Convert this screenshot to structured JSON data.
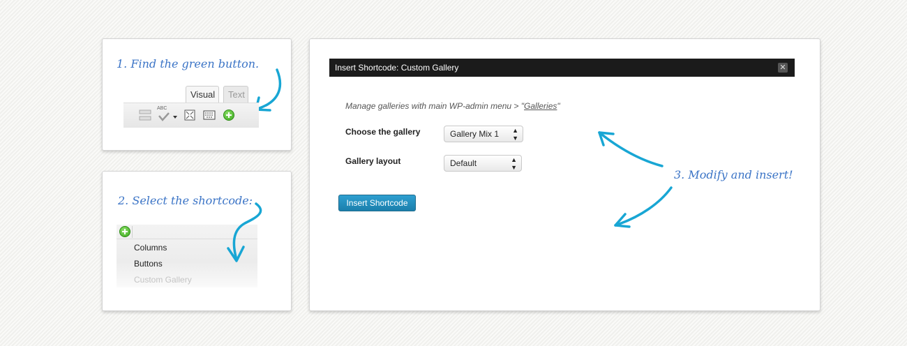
{
  "step1": {
    "caption": "1. Find the green button.",
    "tabs": {
      "visual": "Visual",
      "text": "Text"
    },
    "spellcheck_abbr": "ABC"
  },
  "step2": {
    "caption": "2. Select the shortcode:",
    "menu_items": [
      "Columns",
      "Buttons",
      "Custom Gallery"
    ]
  },
  "step3": {
    "caption": "3. Modify and insert!"
  },
  "dialog": {
    "title": "Insert Shortcode: Custom Gallery",
    "close_symbol": "✕",
    "intro_prefix": "Manage galleries with main WP-admin menu > ",
    "intro_link": "Galleries",
    "gallery_label": "Choose the gallery",
    "gallery_value": "Gallery Mix 1",
    "layout_label": "Gallery layout",
    "layout_value": "Default",
    "insert_button": "Insert Shortcode"
  },
  "colors": {
    "accent_arrow": "#18a6d4",
    "handwriting": "#3b74c6",
    "button": "#1b7fac",
    "plus_green": "#3aa81e"
  }
}
